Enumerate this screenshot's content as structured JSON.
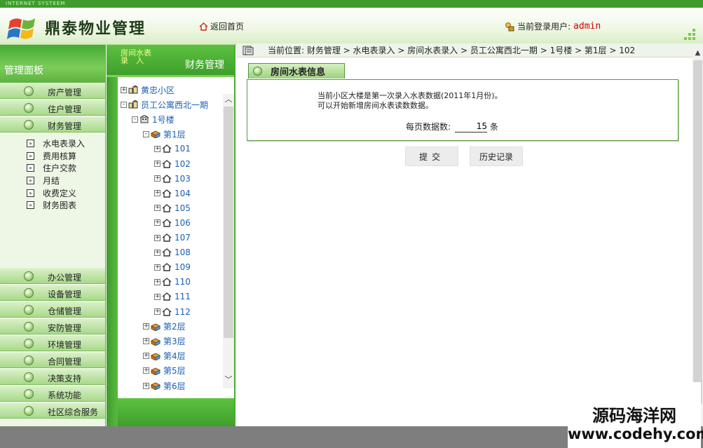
{
  "topbar": {
    "label": "INTERNET SYSTEEM"
  },
  "header": {
    "app_title": "鼎泰物业管理",
    "home_link": "返回首页",
    "user_label": "当前登录用户:",
    "user_name": "admin"
  },
  "left_panel": {
    "title": "管理面板",
    "menu_top": [
      {
        "label": "房产管理"
      },
      {
        "label": "住户管理"
      },
      {
        "label": "财务管理"
      }
    ],
    "sub_items": [
      {
        "label": "水电表录入"
      },
      {
        "label": "费用核算"
      },
      {
        "label": "住户交款"
      },
      {
        "label": "月结"
      },
      {
        "label": "收费定义"
      },
      {
        "label": "财务图表"
      }
    ],
    "menu_bottom": [
      {
        "label": "办公管理"
      },
      {
        "label": "设备管理"
      },
      {
        "label": "仓储管理"
      },
      {
        "label": "安防管理"
      },
      {
        "label": "环境管理"
      },
      {
        "label": "合同管理"
      },
      {
        "label": "决策支持"
      },
      {
        "label": "系统功能"
      },
      {
        "label": "社区综合服务"
      }
    ]
  },
  "tree_panel": {
    "tab_label_line1": "房间水表",
    "tab_label_line2": "录　入",
    "title": "财务管理",
    "nodes": [
      {
        "label": "黄忠小区",
        "sign": "+"
      },
      {
        "label": "员工公寓西北一期",
        "sign": "-"
      },
      {
        "label": "1号楼",
        "sign": "-"
      },
      {
        "label": "第1层",
        "sign": "-"
      },
      {
        "label": "101",
        "sign": "+"
      },
      {
        "label": "102",
        "sign": "+"
      },
      {
        "label": "103",
        "sign": "+"
      },
      {
        "label": "104",
        "sign": "+"
      },
      {
        "label": "105",
        "sign": "+"
      },
      {
        "label": "106",
        "sign": "+"
      },
      {
        "label": "107",
        "sign": "+"
      },
      {
        "label": "108",
        "sign": "+"
      },
      {
        "label": "109",
        "sign": "+"
      },
      {
        "label": "110",
        "sign": "+"
      },
      {
        "label": "111",
        "sign": "+"
      },
      {
        "label": "112",
        "sign": "+"
      },
      {
        "label": "第2层",
        "sign": "+"
      },
      {
        "label": "第3层",
        "sign": "+"
      },
      {
        "label": "第4层",
        "sign": "+"
      },
      {
        "label": "第5层",
        "sign": "+"
      },
      {
        "label": "第6层",
        "sign": "+"
      }
    ]
  },
  "breadcrumb": {
    "text": "当前位置: 财务管理 > 水电表录入 > 房间水表录入 > 员工公寓西北一期 > 1号楼 > 第1层 > 102"
  },
  "main": {
    "section_title": "房间水表信息",
    "message_line1": "当前小区大楼是第一次录入水表数据(2011年1月份)。",
    "message_line2": "可以开始新增房间水表读数数据。",
    "per_page_label": "每页数据数:",
    "per_page_value": "15",
    "per_page_unit": "条",
    "submit_label": "提交",
    "history_label": "历史记录"
  },
  "watermark": {
    "line1": "源码海洋网",
    "line2": "www.codehy.com"
  }
}
